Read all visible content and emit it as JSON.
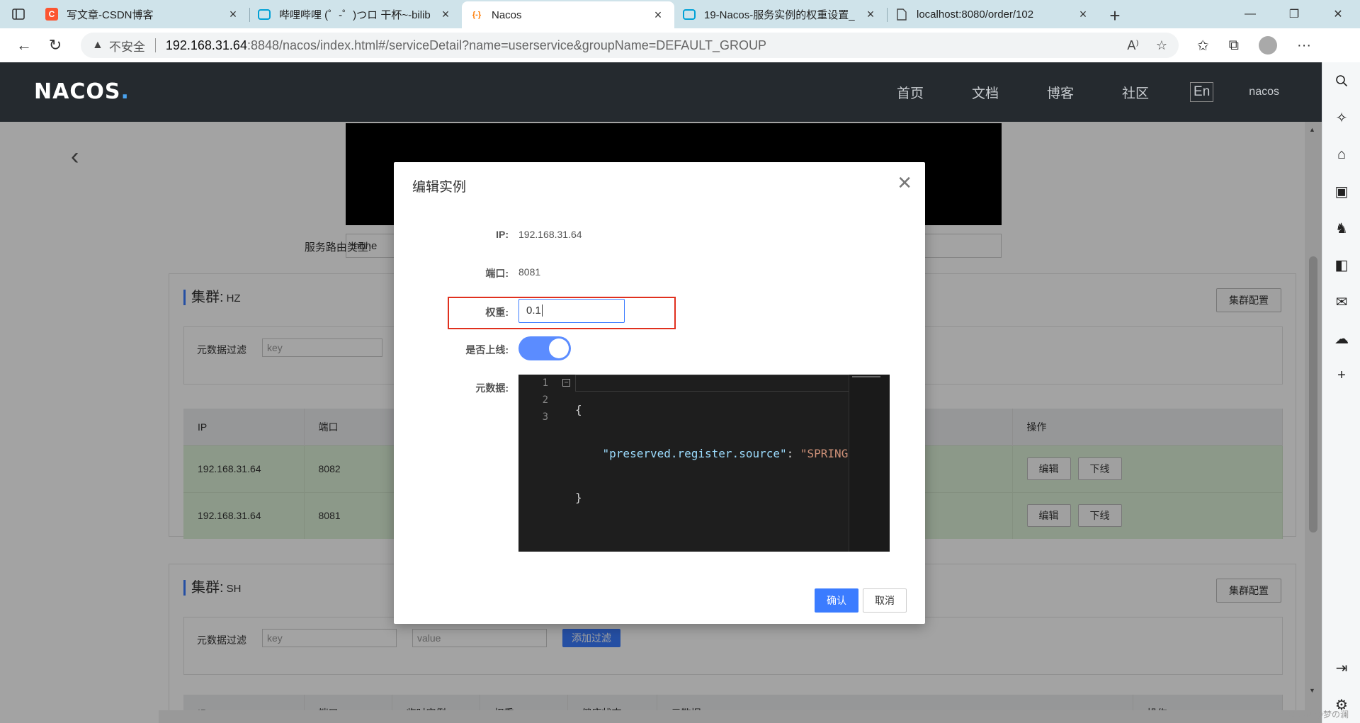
{
  "browser": {
    "tabs": [
      {
        "title": "写文章-CSDN博客",
        "favicon": "C",
        "color": "#fc5531"
      },
      {
        "title": "哔哩哔哩 (゜-゜)つロ 干杯~-bilib",
        "favicon": "tv",
        "color": "#00a1d6"
      },
      {
        "title": "Nacos",
        "favicon": "{-}",
        "color": "#ff7a00"
      },
      {
        "title": "19-Nacos-服务实例的权重设置_",
        "favicon": "tv",
        "color": "#00a1d6"
      },
      {
        "title": "localhost:8080/order/102",
        "favicon": "doc",
        "color": "#666666"
      }
    ],
    "insecure_label": "不安全",
    "url_host": "192.168.31.64",
    "url_rest": ":8848/nacos/index.html#/serviceDetail?name=userservice&groupName=DEFAULT_GROUP"
  },
  "header": {
    "logo_text": "NACOS",
    "logo_dot": ".",
    "nav": [
      "首页",
      "文档",
      "博客",
      "社区"
    ],
    "lang": "En",
    "user": "nacos"
  },
  "service": {
    "route_type_label": "服务路由类型:",
    "route_type_value": "none"
  },
  "clusters": [
    {
      "title": "集群:",
      "name": "HZ",
      "config_label": "集群配置",
      "filter_label": "元数据过滤",
      "filter_key_placeholder": "key",
      "columns": [
        "IP",
        "端口",
        "操作"
      ],
      "rows": [
        {
          "ip": "192.168.31.64",
          "port": "8082",
          "edit": "编辑",
          "offline": "下线"
        },
        {
          "ip": "192.168.31.64",
          "port": "8081",
          "edit": "编辑",
          "offline": "下线"
        }
      ]
    },
    {
      "title": "集群:",
      "name": "SH",
      "config_label": "集群配置",
      "filter_label": "元数据过滤",
      "filter_key_placeholder": "key",
      "filter_value_placeholder": "value",
      "add_filter_label": "添加过滤",
      "columns": [
        "IP",
        "端口",
        "临时实例",
        "权重",
        "健康状态",
        "元数据",
        "操作"
      ]
    }
  ],
  "dialog": {
    "title": "编辑实例",
    "ip_label": "IP:",
    "ip_value": "192.168.31.64",
    "port_label": "端口:",
    "port_value": "8081",
    "weight_label": "权重:",
    "weight_value": "0.1",
    "online_label": "是否上线:",
    "online": true,
    "metadata_label": "元数据:",
    "code_lines": [
      "{",
      "    \"preserved.register.source\": \"SPRING",
      "}"
    ],
    "line_numbers": [
      "1",
      "2",
      "3"
    ],
    "confirm_label": "确认",
    "cancel_label": "取消"
  },
  "watermark": "CSDN @梦の澜"
}
